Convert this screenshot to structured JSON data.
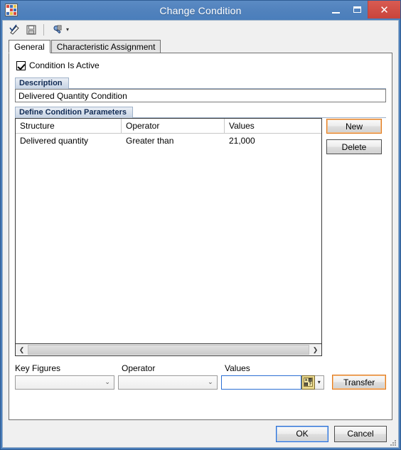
{
  "window": {
    "title": "Change Condition",
    "app_icon": "app-grid-icon",
    "controls": {
      "minimize": "minimize-icon",
      "maximize": "maximize-icon",
      "close": "✕"
    }
  },
  "toolbar": {
    "items": [
      {
        "name": "check-pencil-icon",
        "tooltip": "Check"
      },
      {
        "name": "save-icon",
        "tooltip": "Save"
      },
      {
        "name": "settings-wrench-icon",
        "tooltip": "Settings",
        "caret": "▾"
      }
    ]
  },
  "tabs": [
    {
      "label": "General",
      "active": true
    },
    {
      "label": "Characteristic Assignment",
      "active": false
    }
  ],
  "general": {
    "condition_active": {
      "label": "Condition Is Active",
      "checked": true
    },
    "description_group": {
      "title": "Description"
    },
    "description_value": "Delivered Quantity Condition",
    "parameters_group": {
      "title": "Define Condition Parameters"
    }
  },
  "grid": {
    "columns": [
      "Structure",
      "Operator",
      "Values"
    ],
    "rows": [
      {
        "structure": "Delivered quantity",
        "operator": "Greater than",
        "values": "21,000"
      }
    ],
    "scroll": {
      "left_arrow": "❮",
      "right_arrow": "❯"
    }
  },
  "side_buttons": {
    "new": "New",
    "delete": "Delete"
  },
  "entry_row": {
    "labels": {
      "key_figures": "Key Figures",
      "operator": "Operator",
      "values": "Values"
    },
    "key_figures_value": "",
    "operator_value": "",
    "values_value": "",
    "chevron": "⌄",
    "value_helper_icon": "value-help-icon",
    "split_caret": "▾",
    "transfer": "Transfer"
  },
  "footer": {
    "ok": "OK",
    "cancel": "Cancel"
  },
  "colors": {
    "titlebar": "#4a7ebb",
    "close_button": "#c9443b",
    "focus_orange": "#e07b20",
    "default_blue": "#2b6fd4",
    "group_title_text": "#102a54"
  }
}
